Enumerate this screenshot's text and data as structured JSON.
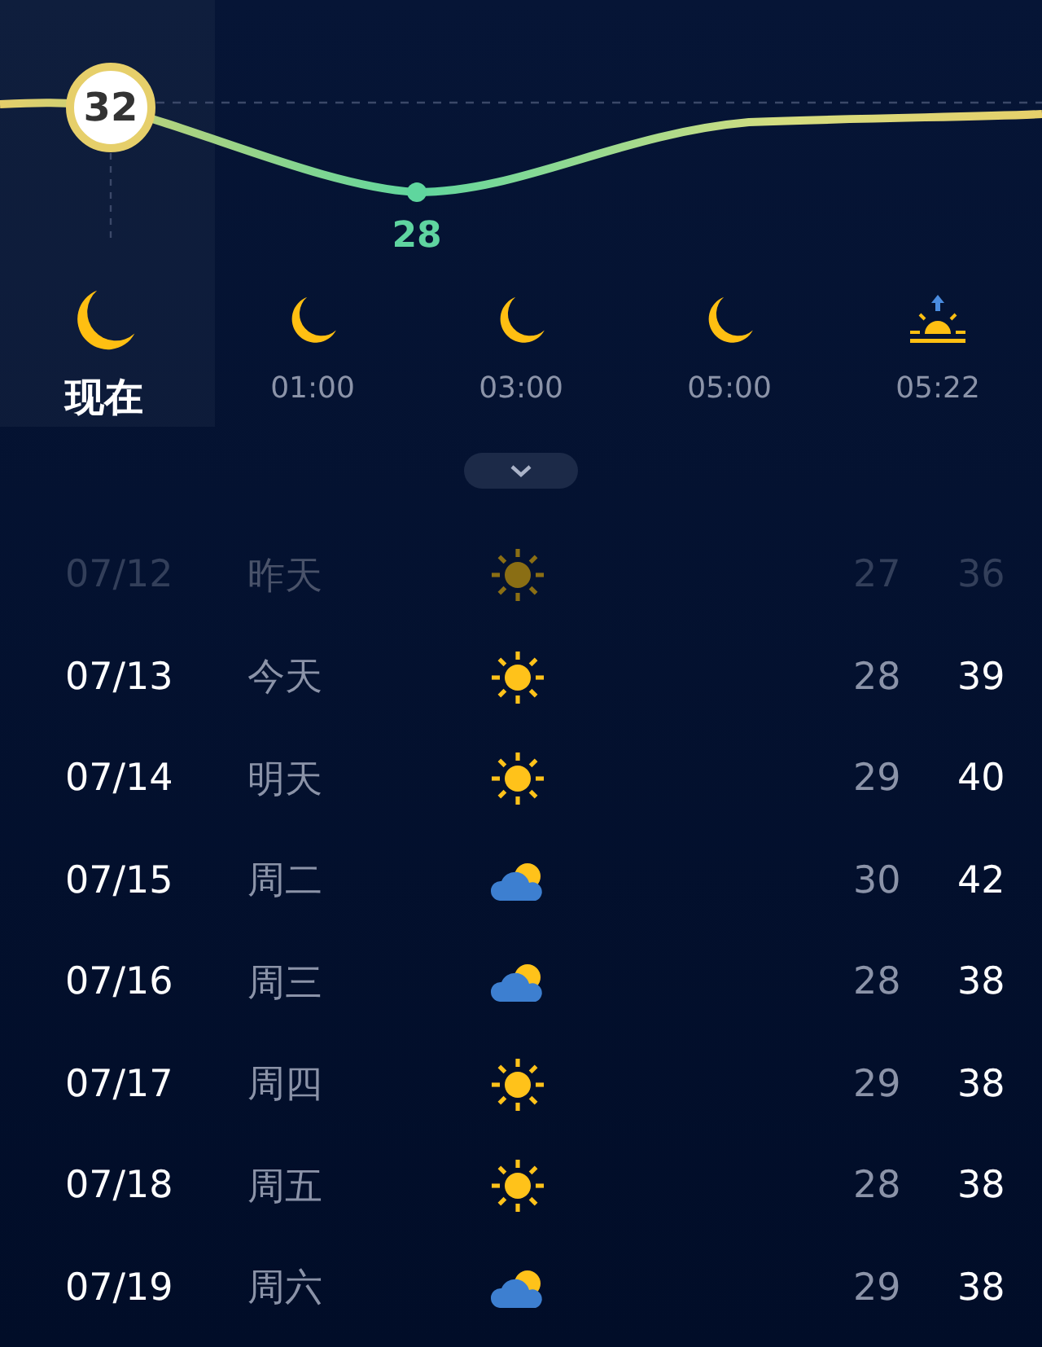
{
  "curve": {
    "current_label": "32",
    "low_label": "28"
  },
  "hours": [
    {
      "label": "现在",
      "kind": "moon",
      "selected": true
    },
    {
      "label": "01:00",
      "kind": "moon",
      "selected": false
    },
    {
      "label": "03:00",
      "kind": "moon",
      "selected": false
    },
    {
      "label": "05:00",
      "kind": "moon",
      "selected": false
    },
    {
      "label": "05:22",
      "kind": "sunrise",
      "selected": false
    }
  ],
  "days": [
    {
      "date": "07/12",
      "day": "昨天",
      "kind": "sunny",
      "low": "27",
      "high": "36",
      "past": true
    },
    {
      "date": "07/13",
      "day": "今天",
      "kind": "sunny",
      "low": "28",
      "high": "39",
      "past": false
    },
    {
      "date": "07/14",
      "day": "明天",
      "kind": "sunny",
      "low": "29",
      "high": "40",
      "past": false
    },
    {
      "date": "07/15",
      "day": "周二",
      "kind": "cloudy",
      "low": "30",
      "high": "42",
      "past": false
    },
    {
      "date": "07/16",
      "day": "周三",
      "kind": "cloudy",
      "low": "28",
      "high": "38",
      "past": false
    },
    {
      "date": "07/17",
      "day": "周四",
      "kind": "sunny",
      "low": "29",
      "high": "38",
      "past": false
    },
    {
      "date": "07/18",
      "day": "周五",
      "kind": "sunny",
      "low": "28",
      "high": "38",
      "past": false
    },
    {
      "date": "07/19",
      "day": "周六",
      "kind": "cloudy",
      "low": "29",
      "high": "38",
      "past": false
    }
  ]
}
